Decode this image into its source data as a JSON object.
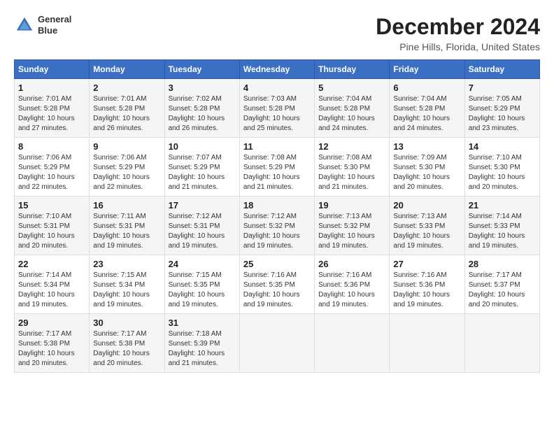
{
  "logo": {
    "line1": "General",
    "line2": "Blue"
  },
  "title": "December 2024",
  "location": "Pine Hills, Florida, United States",
  "headers": [
    "Sunday",
    "Monday",
    "Tuesday",
    "Wednesday",
    "Thursday",
    "Friday",
    "Saturday"
  ],
  "weeks": [
    [
      {
        "day": "1",
        "sunrise": "Sunrise: 7:01 AM",
        "sunset": "Sunset: 5:28 PM",
        "daylight": "Daylight: 10 hours and 27 minutes."
      },
      {
        "day": "2",
        "sunrise": "Sunrise: 7:01 AM",
        "sunset": "Sunset: 5:28 PM",
        "daylight": "Daylight: 10 hours and 26 minutes."
      },
      {
        "day": "3",
        "sunrise": "Sunrise: 7:02 AM",
        "sunset": "Sunset: 5:28 PM",
        "daylight": "Daylight: 10 hours and 26 minutes."
      },
      {
        "day": "4",
        "sunrise": "Sunrise: 7:03 AM",
        "sunset": "Sunset: 5:28 PM",
        "daylight": "Daylight: 10 hours and 25 minutes."
      },
      {
        "day": "5",
        "sunrise": "Sunrise: 7:04 AM",
        "sunset": "Sunset: 5:28 PM",
        "daylight": "Daylight: 10 hours and 24 minutes."
      },
      {
        "day": "6",
        "sunrise": "Sunrise: 7:04 AM",
        "sunset": "Sunset: 5:28 PM",
        "daylight": "Daylight: 10 hours and 24 minutes."
      },
      {
        "day": "7",
        "sunrise": "Sunrise: 7:05 AM",
        "sunset": "Sunset: 5:29 PM",
        "daylight": "Daylight: 10 hours and 23 minutes."
      }
    ],
    [
      {
        "day": "8",
        "sunrise": "Sunrise: 7:06 AM",
        "sunset": "Sunset: 5:29 PM",
        "daylight": "Daylight: 10 hours and 22 minutes."
      },
      {
        "day": "9",
        "sunrise": "Sunrise: 7:06 AM",
        "sunset": "Sunset: 5:29 PM",
        "daylight": "Daylight: 10 hours and 22 minutes."
      },
      {
        "day": "10",
        "sunrise": "Sunrise: 7:07 AM",
        "sunset": "Sunset: 5:29 PM",
        "daylight": "Daylight: 10 hours and 21 minutes."
      },
      {
        "day": "11",
        "sunrise": "Sunrise: 7:08 AM",
        "sunset": "Sunset: 5:29 PM",
        "daylight": "Daylight: 10 hours and 21 minutes."
      },
      {
        "day": "12",
        "sunrise": "Sunrise: 7:08 AM",
        "sunset": "Sunset: 5:30 PM",
        "daylight": "Daylight: 10 hours and 21 minutes."
      },
      {
        "day": "13",
        "sunrise": "Sunrise: 7:09 AM",
        "sunset": "Sunset: 5:30 PM",
        "daylight": "Daylight: 10 hours and 20 minutes."
      },
      {
        "day": "14",
        "sunrise": "Sunrise: 7:10 AM",
        "sunset": "Sunset: 5:30 PM",
        "daylight": "Daylight: 10 hours and 20 minutes."
      }
    ],
    [
      {
        "day": "15",
        "sunrise": "Sunrise: 7:10 AM",
        "sunset": "Sunset: 5:31 PM",
        "daylight": "Daylight: 10 hours and 20 minutes."
      },
      {
        "day": "16",
        "sunrise": "Sunrise: 7:11 AM",
        "sunset": "Sunset: 5:31 PM",
        "daylight": "Daylight: 10 hours and 19 minutes."
      },
      {
        "day": "17",
        "sunrise": "Sunrise: 7:12 AM",
        "sunset": "Sunset: 5:31 PM",
        "daylight": "Daylight: 10 hours and 19 minutes."
      },
      {
        "day": "18",
        "sunrise": "Sunrise: 7:12 AM",
        "sunset": "Sunset: 5:32 PM",
        "daylight": "Daylight: 10 hours and 19 minutes."
      },
      {
        "day": "19",
        "sunrise": "Sunrise: 7:13 AM",
        "sunset": "Sunset: 5:32 PM",
        "daylight": "Daylight: 10 hours and 19 minutes."
      },
      {
        "day": "20",
        "sunrise": "Sunrise: 7:13 AM",
        "sunset": "Sunset: 5:33 PM",
        "daylight": "Daylight: 10 hours and 19 minutes."
      },
      {
        "day": "21",
        "sunrise": "Sunrise: 7:14 AM",
        "sunset": "Sunset: 5:33 PM",
        "daylight": "Daylight: 10 hours and 19 minutes."
      }
    ],
    [
      {
        "day": "22",
        "sunrise": "Sunrise: 7:14 AM",
        "sunset": "Sunset: 5:34 PM",
        "daylight": "Daylight: 10 hours and 19 minutes."
      },
      {
        "day": "23",
        "sunrise": "Sunrise: 7:15 AM",
        "sunset": "Sunset: 5:34 PM",
        "daylight": "Daylight: 10 hours and 19 minutes."
      },
      {
        "day": "24",
        "sunrise": "Sunrise: 7:15 AM",
        "sunset": "Sunset: 5:35 PM",
        "daylight": "Daylight: 10 hours and 19 minutes."
      },
      {
        "day": "25",
        "sunrise": "Sunrise: 7:16 AM",
        "sunset": "Sunset: 5:35 PM",
        "daylight": "Daylight: 10 hours and 19 minutes."
      },
      {
        "day": "26",
        "sunrise": "Sunrise: 7:16 AM",
        "sunset": "Sunset: 5:36 PM",
        "daylight": "Daylight: 10 hours and 19 minutes."
      },
      {
        "day": "27",
        "sunrise": "Sunrise: 7:16 AM",
        "sunset": "Sunset: 5:36 PM",
        "daylight": "Daylight: 10 hours and 19 minutes."
      },
      {
        "day": "28",
        "sunrise": "Sunrise: 7:17 AM",
        "sunset": "Sunset: 5:37 PM",
        "daylight": "Daylight: 10 hours and 20 minutes."
      }
    ],
    [
      {
        "day": "29",
        "sunrise": "Sunrise: 7:17 AM",
        "sunset": "Sunset: 5:38 PM",
        "daylight": "Daylight: 10 hours and 20 minutes."
      },
      {
        "day": "30",
        "sunrise": "Sunrise: 7:17 AM",
        "sunset": "Sunset: 5:38 PM",
        "daylight": "Daylight: 10 hours and 20 minutes."
      },
      {
        "day": "31",
        "sunrise": "Sunrise: 7:18 AM",
        "sunset": "Sunset: 5:39 PM",
        "daylight": "Daylight: 10 hours and 21 minutes."
      },
      null,
      null,
      null,
      null
    ]
  ]
}
